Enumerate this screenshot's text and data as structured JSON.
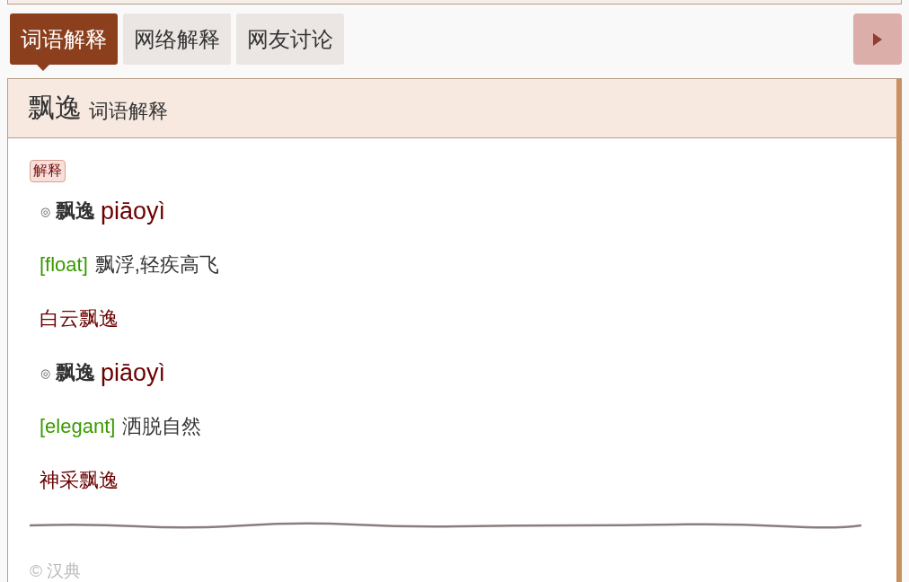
{
  "tabs": [
    {
      "label": "词语解释",
      "selected": true
    },
    {
      "label": "网络解释",
      "selected": false
    },
    {
      "label": "网友讨论",
      "selected": false
    }
  ],
  "header": {
    "word": "飘逸",
    "subtitle": "词语解释"
  },
  "badge": "解释",
  "senses": [
    {
      "mark": "◎",
      "word": "飘逸",
      "pinyin": "piāoyì",
      "gloss": "[float]",
      "definition": "飘浮,轻疾高飞",
      "example": "白云飘逸"
    },
    {
      "mark": "◎",
      "word": "飘逸",
      "pinyin": "piāoyì",
      "gloss": "[elegant]",
      "definition": "洒脱自然",
      "example": "神采飘逸"
    }
  ],
  "footer": "© 汉典"
}
